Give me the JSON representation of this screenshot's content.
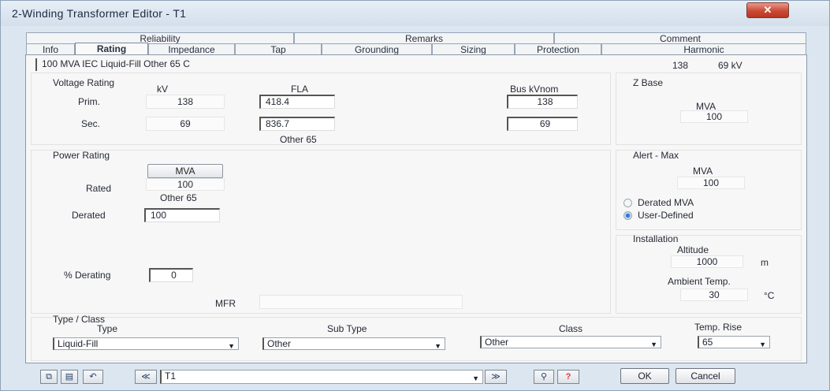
{
  "window": {
    "title": "2-Winding Transformer Editor - T1",
    "close_glyph": "✕"
  },
  "tabs_top": [
    "Reliability",
    "Remarks",
    "Comment"
  ],
  "tabs_bottom": [
    "Info",
    "Rating",
    "Impedance",
    "Tap",
    "Grounding",
    "Sizing",
    "Protection",
    "Harmonic"
  ],
  "active_tab": "Rating",
  "header": {
    "summary": "100 MVA  IEC  Liquid-Fill  Other  65 C",
    "kv_left": "138",
    "kv_right": "69 kV"
  },
  "voltage_rating": {
    "title": "Voltage Rating",
    "col_kv": "kV",
    "col_fla": "FLA",
    "col_bus": "Bus kVnom",
    "rows": [
      {
        "label": "Prim.",
        "kv": "138",
        "fla": "418.4",
        "bus": "138"
      },
      {
        "label": "Sec.",
        "kv": "69",
        "fla": "836.7",
        "bus": "69"
      }
    ],
    "note": "Other 65"
  },
  "z_base": {
    "title": "Z Base",
    "unit": "MVA",
    "value": "100"
  },
  "power_rating": {
    "title": "Power Rating",
    "unit_button": "MVA",
    "rated_label": "Rated",
    "rated_value": "100",
    "rated_note": "Other 65",
    "derated_label": "Derated",
    "derated_value": "100",
    "pct_label": "% Derating",
    "pct_value": "0",
    "mfr_label": "MFR",
    "mfr_value": ""
  },
  "alert": {
    "title": "Alert - Max",
    "unit": "MVA",
    "value": "100",
    "opt1": "Derated MVA",
    "opt2": "User-Defined",
    "selected": "User-Defined"
  },
  "installation": {
    "title": "Installation",
    "altitude_label": "Altitude",
    "altitude": "1000",
    "altitude_unit": "m",
    "ambient_label": "Ambient Temp.",
    "ambient": "30",
    "ambient_unit": "°C"
  },
  "type_class": {
    "title": "Type / Class",
    "type_label": "Type",
    "type": "Liquid-Fill",
    "subtype_label": "Sub Type",
    "subtype": "Other",
    "class_label": "Class",
    "class": "Other",
    "temp_label": "Temp. Rise",
    "temp": "65"
  },
  "footer": {
    "id": "T1",
    "ok": "OK",
    "cancel": "Cancel"
  },
  "colors": {
    "close": "#c94a35",
    "radio_selected": "#3a77d6",
    "help": "#d83a3a"
  }
}
